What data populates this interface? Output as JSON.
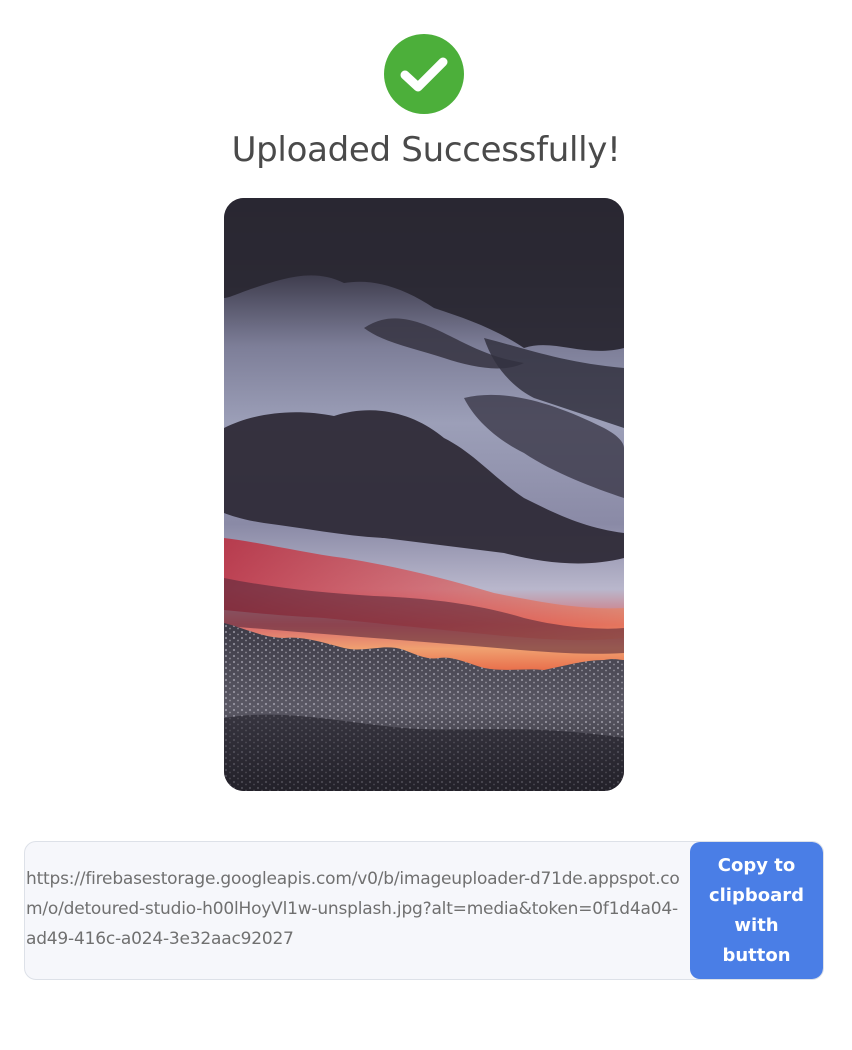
{
  "status": {
    "icon": "check-circle-icon",
    "title": "Uploaded Successfully!",
    "success_color": "#4caf3a"
  },
  "preview": {
    "image": "uploaded-image-preview"
  },
  "link": {
    "url": "https://firebasestorage.googleapis.com/v0/b/imageuploader-d71de.appspot.com/o/detoured-studio-h00lHoyVl1w-unsplash.jpg?alt=media&token=0f1d4a04-ad49-416c-a024-3e32aac92027",
    "copy_button_label": "Copy to clipboard with button",
    "button_color": "#4a7ee6"
  }
}
